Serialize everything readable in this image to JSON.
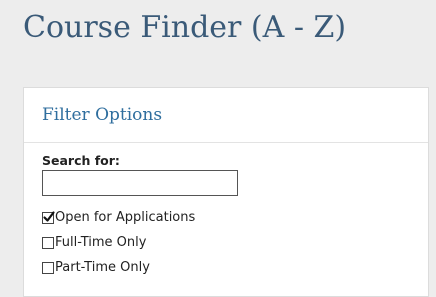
{
  "page": {
    "title": "Course Finder (A - Z)"
  },
  "filter_panel": {
    "title": "Filter Options",
    "search": {
      "label": "Search for:",
      "value": "",
      "placeholder": ""
    },
    "options": [
      {
        "label": "Open for Applications",
        "checked": true
      },
      {
        "label": "Full-Time Only",
        "checked": false
      },
      {
        "label": "Part-Time Only",
        "checked": false
      }
    ]
  },
  "icons": {
    "check": "check-icon"
  },
  "colors": {
    "background": "#ededed",
    "title_text": "#3a5a78",
    "panel_title_text": "#2f6e9e",
    "panel_background": "#ffffff"
  }
}
